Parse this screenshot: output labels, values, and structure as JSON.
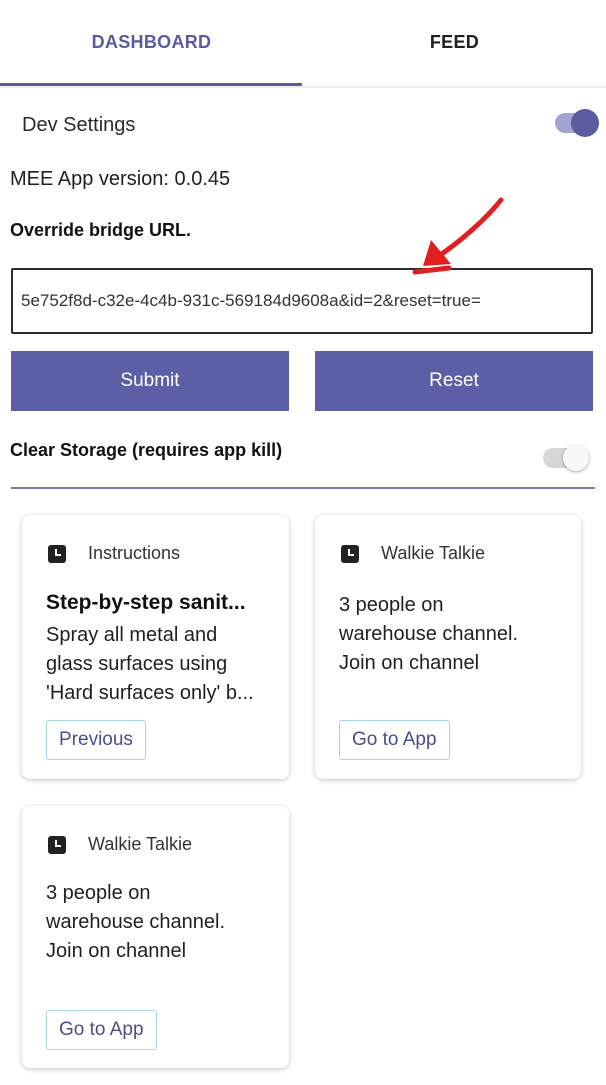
{
  "tabs": {
    "dashboard": "DASHBOARD",
    "feed": "FEED"
  },
  "dev_settings": {
    "label": "Dev Settings",
    "enabled": true
  },
  "app_version": "MEE App version: 0.0.45",
  "override": {
    "label": "Override bridge URL.",
    "value": "=5e752f8d-c32e-4c4b-931c-569184d9608a&id=2&reset=true"
  },
  "buttons": {
    "submit": "Submit",
    "reset": "Reset"
  },
  "clear_storage": {
    "label": "Clear Storage (requires app kill)",
    "enabled": false
  },
  "colors": {
    "accent": "#5b5b9f",
    "button": "#5d5fa6",
    "annotation_arrow": "#e02020"
  },
  "cards": [
    {
      "icon": "clock-icon",
      "category": "Instructions",
      "title": "Step-by-step sanit...",
      "body": [
        "Spray all metal and",
        "glass surfaces using",
        "'Hard surfaces only' b..."
      ],
      "button": "Previous"
    },
    {
      "icon": "clock-icon",
      "category": "Walkie Talkie",
      "body": [
        "3 people on",
        "warehouse channel.",
        "Join on channel"
      ],
      "button": "Go to App"
    },
    {
      "icon": "clock-icon",
      "category": "Walkie Talkie",
      "body": [
        "3 people on",
        "warehouse channel.",
        "Join on channel"
      ],
      "button": "Go to App"
    }
  ]
}
